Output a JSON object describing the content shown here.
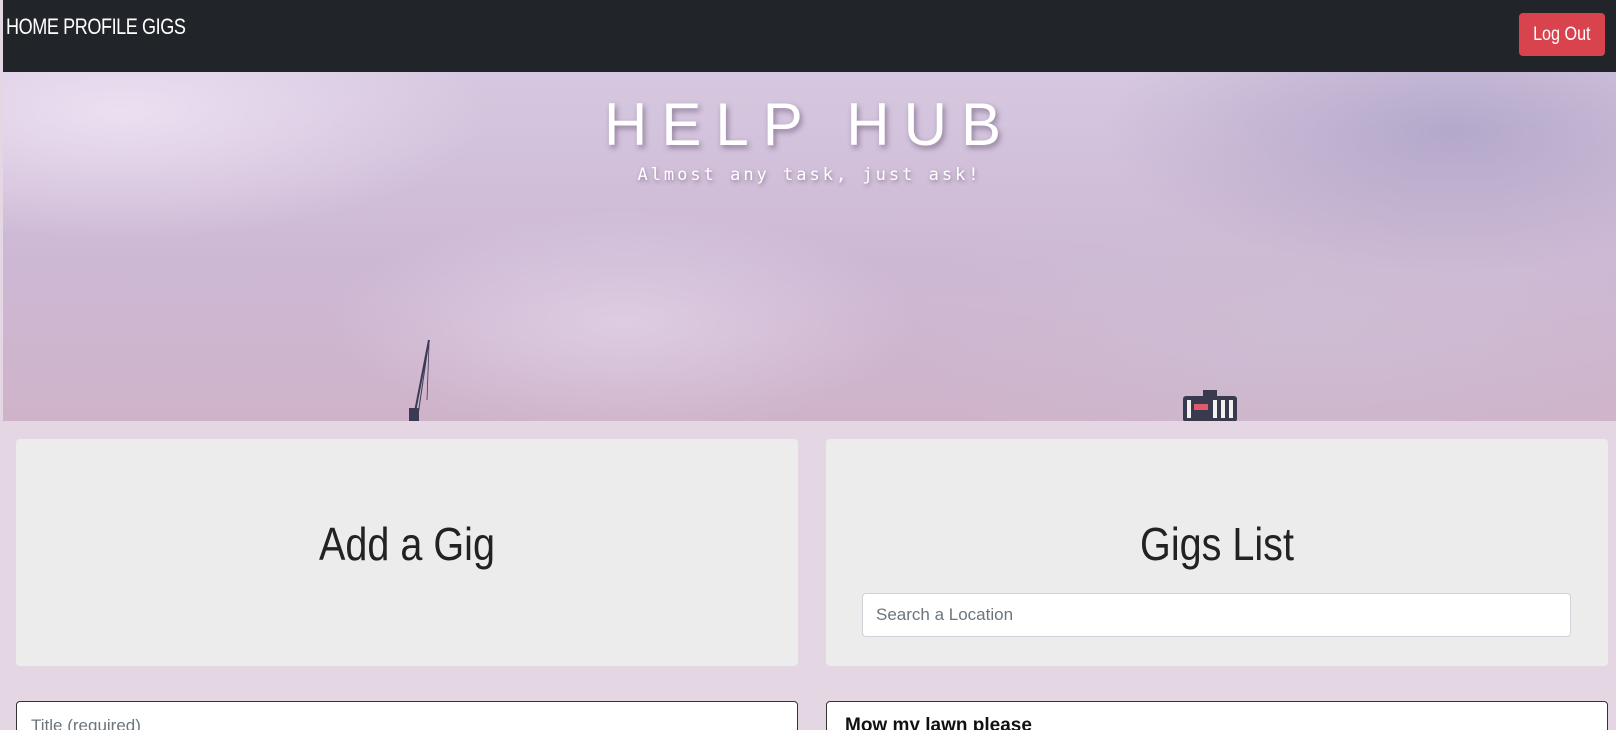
{
  "nav": {
    "links": [
      "HOME",
      "PROFILE",
      "GIGS"
    ],
    "logout_label": "Log Out"
  },
  "hero": {
    "title": "HELP HUB",
    "subtitle": "Almost any task, just ask!"
  },
  "add_gig": {
    "heading": "Add a Gig",
    "title_placeholder": "Title (required)"
  },
  "gigs_list": {
    "heading": "Gigs List",
    "search_placeholder": "Search a Location",
    "items": [
      {
        "title": "Mow my lawn please"
      }
    ]
  },
  "colors": {
    "navbar": "#212529",
    "logout": "#d9434e",
    "panel": "#ececec",
    "background": "#e4d7e3"
  },
  "icons": {
    "hero_crane": "crane-silhouette",
    "hero_tower": "water-tower-silhouette"
  }
}
